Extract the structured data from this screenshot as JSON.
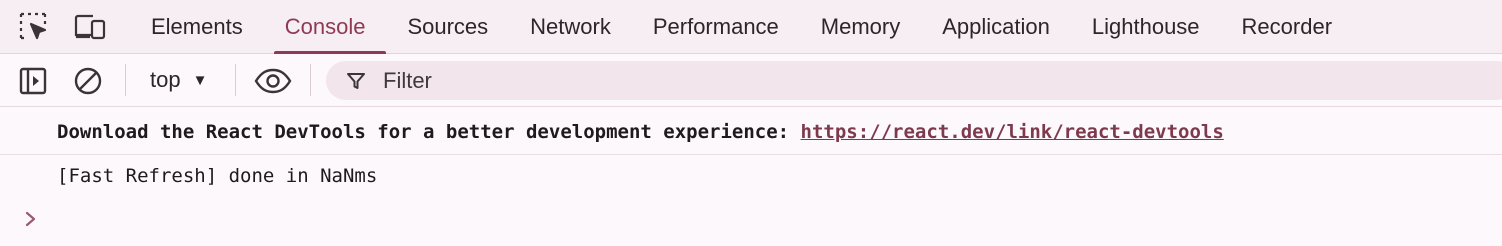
{
  "toolbar_icons": {
    "inspect": "inspect-element-icon",
    "device": "device-toolbar-icon"
  },
  "tabs": [
    {
      "label": "Elements",
      "active": false
    },
    {
      "label": "Console",
      "active": true
    },
    {
      "label": "Sources",
      "active": false
    },
    {
      "label": "Network",
      "active": false
    },
    {
      "label": "Performance",
      "active": false
    },
    {
      "label": "Memory",
      "active": false
    },
    {
      "label": "Application",
      "active": false
    },
    {
      "label": "Lighthouse",
      "active": false
    },
    {
      "label": "Recorder",
      "active": false
    }
  ],
  "console_toolbar": {
    "sidebar_icon": "sidebar-toggle-icon",
    "clear_icon": "clear-console-icon",
    "context": "top",
    "eye_icon": "live-expression-icon",
    "filter_icon": "filter-icon",
    "filter_placeholder": "Filter"
  },
  "messages": {
    "devtools_text": "Download the React DevTools for a better development experience: ",
    "devtools_link": "https://react.dev/link/react-devtools",
    "fast_refresh": "[Fast Refresh] done in NaNms"
  },
  "colors": {
    "accent": "#8d3a52",
    "link": "#7d3a4d",
    "tabbar_bg": "#f6eef3",
    "console_bg": "#fdf8fb"
  }
}
